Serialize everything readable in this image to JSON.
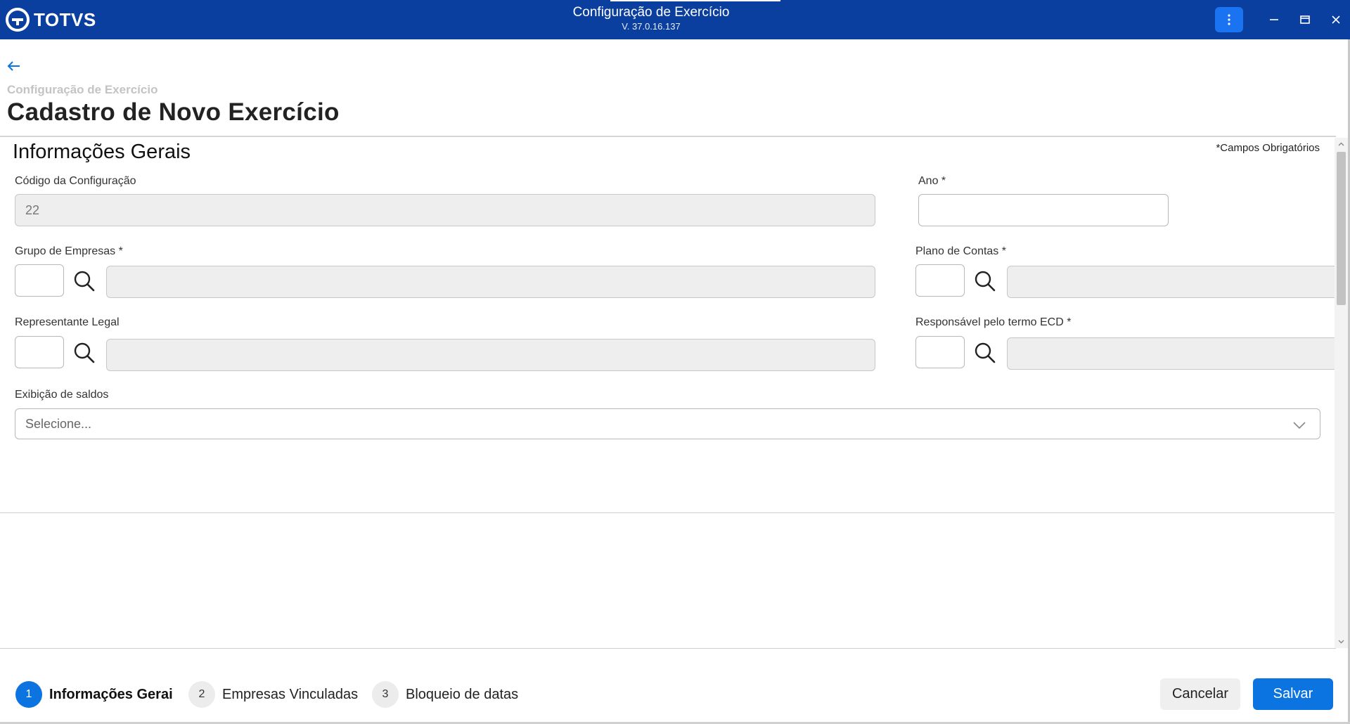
{
  "window": {
    "brand": "TOTVS",
    "title": "Configuração de Exercício",
    "version": "V. 37.0.16.137",
    "more_icon": "more-vertical-icon",
    "accent_color": "#0b3f9f"
  },
  "header": {
    "breadcrumb": "Configuração de Exercício",
    "title": "Cadastro de Novo Exercício"
  },
  "form": {
    "section_title": "Informações Gerais",
    "required_note": "*Campos Obrigatórios",
    "codigo": {
      "label": "Código da Configuração",
      "value": "22"
    },
    "ano": {
      "label": "Ano *",
      "value": ""
    },
    "grupo_empresas": {
      "label": "Grupo de Empresas *",
      "code": "",
      "description": ""
    },
    "plano_contas": {
      "label": "Plano de Contas *",
      "code": "",
      "description": ""
    },
    "representante": {
      "label": "Representante Legal",
      "code": "",
      "description": ""
    },
    "responsavel": {
      "label": "Responsável pelo termo ECD *",
      "code": "",
      "description": ""
    },
    "exibicao": {
      "label": "Exibição de saldos",
      "placeholder": "Selecione..."
    }
  },
  "stepper": [
    {
      "number": "1",
      "label": "Informações Gerais",
      "active": true
    },
    {
      "number": "2",
      "label": "Empresas Vinculadas",
      "active": false
    },
    {
      "number": "3",
      "label": "Bloqueio de datas",
      "active": false
    }
  ],
  "actions": {
    "cancel": "Cancelar",
    "save": "Salvar",
    "primary_color": "#0c74e0"
  }
}
